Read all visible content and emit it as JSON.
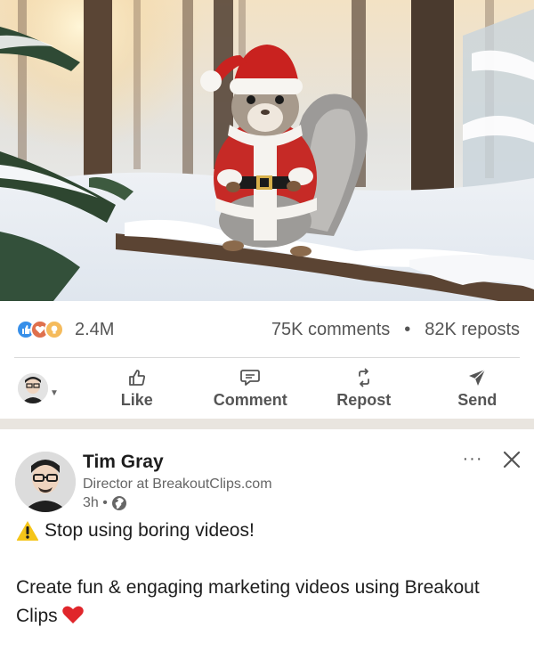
{
  "post": {
    "image_alt": "Squirrel in a Santa costume on a snowy branch",
    "reactions": {
      "icons": [
        "like-icon",
        "love-icon",
        "insightful-icon"
      ],
      "count": "2.4M"
    },
    "comments": "75K comments",
    "separator": "•",
    "reposts": "82K reposts"
  },
  "actions": {
    "like": "Like",
    "comment": "Comment",
    "repost": "Repost",
    "send": "Send"
  },
  "next_post": {
    "author_name": "Tim Gray",
    "author_headline": "Director at BreakoutClips.com",
    "time": "3h •",
    "visibility_icon": "globe-icon",
    "more": "···",
    "line1": "Stop using boring videos!",
    "line2": "Create fun & engaging marketing videos using Breakout Clips"
  },
  "colors": {
    "like_blue": "#378fe9",
    "love_red": "#df704d",
    "insightful_yellow": "#f5bb5c",
    "separator_band": "#e9e5df"
  }
}
